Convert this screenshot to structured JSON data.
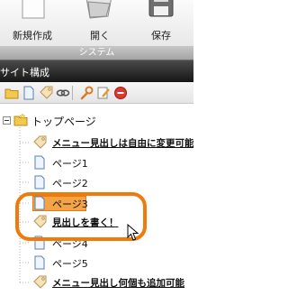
{
  "ribbon": {
    "buttons": [
      {
        "label": "新規作成",
        "icon": "new-document-icon"
      },
      {
        "label": "開く",
        "icon": "open-folder-icon"
      },
      {
        "label": "保存",
        "icon": "save-disk-icon"
      }
    ],
    "group_label": "システム"
  },
  "panel": {
    "title": "サイト構成"
  },
  "toolbar": {
    "icons": [
      "open-folder-icon",
      "new-page-icon",
      "tag-icon",
      "link-icon",
      "wrench-icon",
      "edit-icon",
      "delete-icon"
    ]
  },
  "tree": {
    "root": {
      "label": "トップページ",
      "icon": "folder-icon"
    },
    "items": [
      {
        "label": "メニュー見出しは自由に変更可能",
        "icon": "tag-icon",
        "bold": true
      },
      {
        "label": "ページ1",
        "icon": "page-icon",
        "bold": false
      },
      {
        "label": "ページ2",
        "icon": "page-icon",
        "bold": false
      },
      {
        "label": "ページ3",
        "icon": "page-icon",
        "bold": false,
        "selected": true
      },
      {
        "label": "見出しを書く！",
        "icon": "tag-icon",
        "bold": true
      },
      {
        "label": "ページ4",
        "icon": "page-icon",
        "bold": false
      },
      {
        "label": "ページ5",
        "icon": "page-icon",
        "bold": false
      },
      {
        "label": "メニュー見出し何個も追加可能",
        "icon": "tag-icon",
        "bold": true
      }
    ]
  },
  "colors": {
    "highlight": "#f07a0c",
    "selection": "#f5a347",
    "header_dark": "#222222"
  }
}
